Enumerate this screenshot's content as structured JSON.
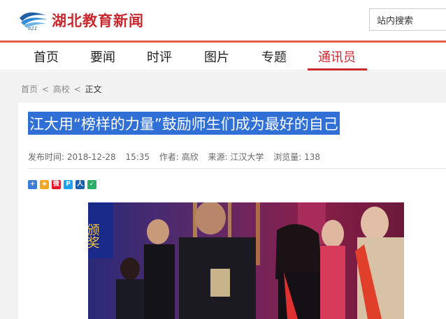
{
  "header": {
    "logo_text": "湖北教育新闻",
    "logo_subtext": "e21",
    "search_placeholder": "站内搜索"
  },
  "nav": {
    "items": [
      {
        "label": "首页",
        "active": false
      },
      {
        "label": "要闻",
        "active": false
      },
      {
        "label": "时评",
        "active": false
      },
      {
        "label": "图片",
        "active": false
      },
      {
        "label": "专题",
        "active": false
      },
      {
        "label": "通讯员",
        "active": true
      }
    ]
  },
  "breadcrumb": {
    "items": [
      "首页",
      "<",
      "高校",
      "<",
      "正文"
    ]
  },
  "article": {
    "title": "江大用“榜样的力量”鼓励师生们成为最好的自己",
    "published_label": "发布时间: 2018-12-28",
    "time": "15:35",
    "author": "作者: 高欣",
    "source": "来源: 江汉大学",
    "views": "浏览量: 138"
  },
  "share": {
    "icons": [
      "share-more-icon",
      "qzone-icon",
      "weibo-icon",
      "tencent-weibo-icon",
      "renren-icon",
      "wechat-icon"
    ],
    "glyphs": [
      "+",
      "★",
      "微",
      "P",
      "人",
      "✓"
    ],
    "colors": [
      "#3b7dd8",
      "#f5a623",
      "#e6162d",
      "#1da1f2",
      "#1e5fae",
      "#2aae67"
    ]
  },
  "photo": {
    "banner_text": "颁奖"
  },
  "colors": {
    "brand_red": "#c8282e",
    "nav_rule": "#e8604a",
    "title_highlight": "#2f6fd6"
  }
}
